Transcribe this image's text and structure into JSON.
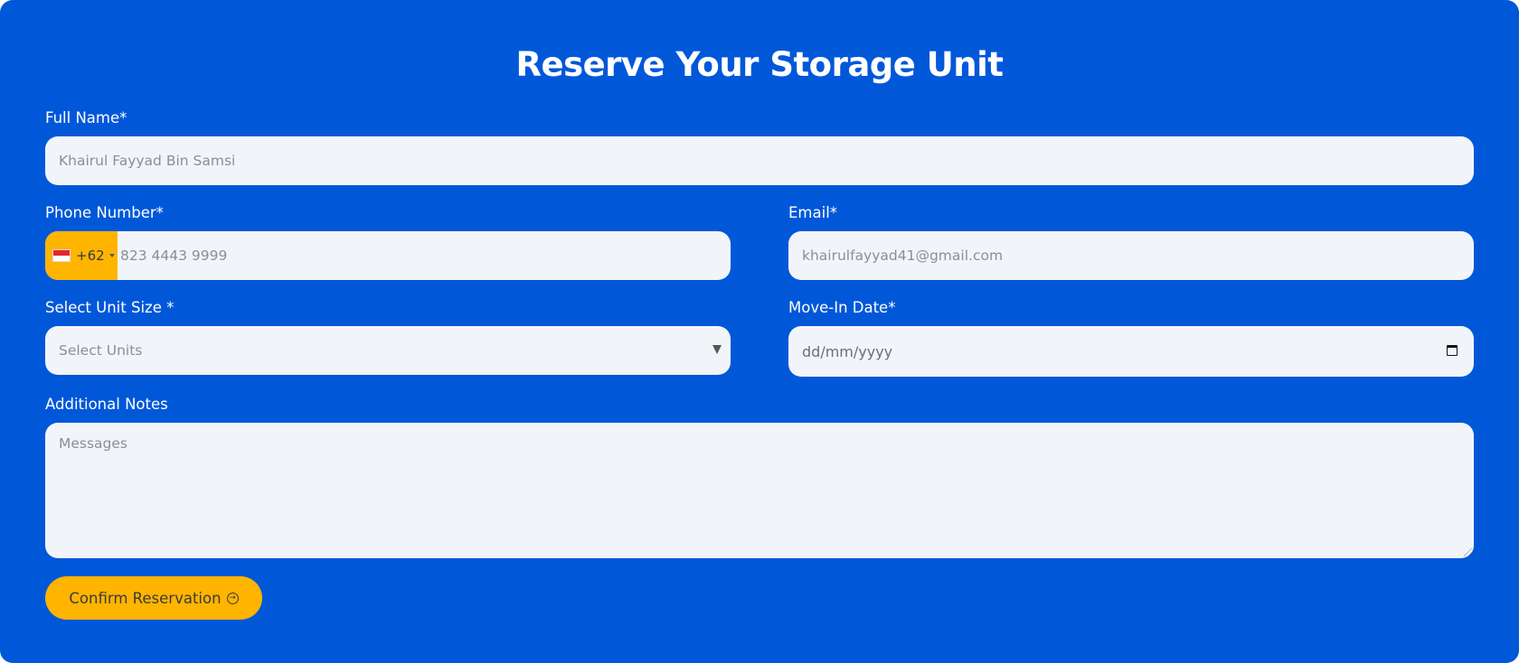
{
  "form": {
    "title": "Reserve Your Storage Unit",
    "full_name": {
      "label": "Full Name*",
      "placeholder": "Khairul Fayyad Bin Samsi"
    },
    "phone": {
      "label": "Phone Number*",
      "country_code": "+62",
      "flag": "indonesia-flag-icon",
      "placeholder": "823 4443 9999"
    },
    "email": {
      "label": "Email*",
      "placeholder": "khairulfayyad41@gmail.com"
    },
    "unit_size": {
      "label": "Select Unit Size *",
      "selected": "Select Units"
    },
    "move_in": {
      "label": "Move-In Date*",
      "placeholder": "dd/mm/yyyy"
    },
    "notes": {
      "label": "Additional Notes",
      "placeholder": "Messages"
    },
    "submit_label": "Confirm Reservation"
  },
  "colors": {
    "background": "#0058d9",
    "accent": "#ffb400",
    "field": "#f1f5f9"
  }
}
